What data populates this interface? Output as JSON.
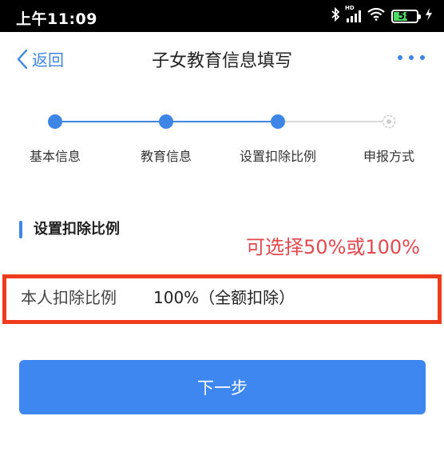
{
  "status_bar": {
    "time": "上午11:09",
    "hd_label": "HD",
    "battery_level": "58",
    "icons": [
      "bluetooth-icon",
      "signal-icon",
      "wifi-icon",
      "battery-icon",
      "charging-icon"
    ]
  },
  "nav": {
    "back_label": "返回",
    "title": "子女教育信息填写",
    "more_icon": "more-dots-icon"
  },
  "steps": [
    {
      "label": "基本信息",
      "state": "done"
    },
    {
      "label": "教育信息",
      "state": "done"
    },
    {
      "label": "设置扣除比例",
      "state": "current"
    },
    {
      "label": "申报方式",
      "state": "pending"
    }
  ],
  "section": {
    "title": "设置扣除比例",
    "annotation": "可选择50%或100%"
  },
  "ratio": {
    "label": "本人扣除比例",
    "value": "100%（全额扣除）"
  },
  "next_button": {
    "label": "下一步"
  },
  "colors": {
    "accent": "#3e86e5",
    "button": "#3e86f0",
    "highlight_border": "#ee3b1d",
    "annotation": "#e4484f"
  }
}
